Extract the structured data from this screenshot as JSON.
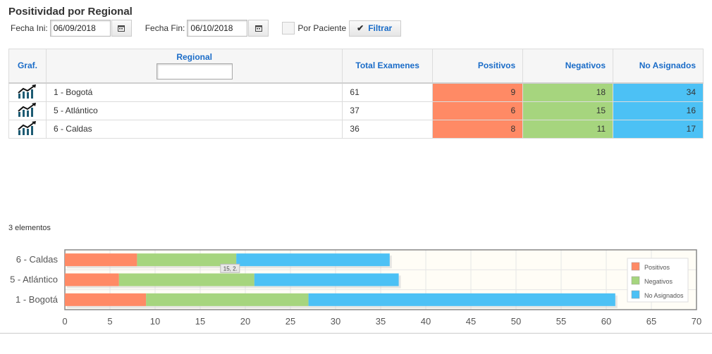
{
  "page": {
    "title": "Positividad por Regional"
  },
  "filters": {
    "fecha_ini_label": "Fecha Ini:",
    "fecha_ini_value": "06/09/2018",
    "fecha_fin_label": "Fecha Fin:",
    "fecha_fin_value": "06/10/2018",
    "por_paciente_label": "Por Paciente",
    "filtrar_label": "Filtrar",
    "calendar_icon": "calendar-icon"
  },
  "table": {
    "headers": {
      "graf": "Graf.",
      "regional": "Regional",
      "total": "Total Examenes",
      "positivos": "Positivos",
      "negativos": "Negativos",
      "no_asignados": "No Asignados"
    },
    "rows": [
      {
        "regional": "1 - Bogotá",
        "total": "61",
        "positivos": "9",
        "negativos": "18",
        "no_asignados": "34"
      },
      {
        "regional": "5 - Atlántico",
        "total": "37",
        "positivos": "6",
        "negativos": "15",
        "no_asignados": "16"
      },
      {
        "regional": "6 - Caldas",
        "total": "36",
        "positivos": "8",
        "negativos": "11",
        "no_asignados": "17"
      }
    ],
    "row_icon": "trend-chart-icon"
  },
  "count_label": "3 elementos",
  "colors": {
    "positivos": "#ff8a65",
    "negativos": "#a6d57e",
    "no_asignados": "#4cc1f5"
  },
  "chart_data": {
    "type": "bar",
    "orientation": "horizontal",
    "stacked": true,
    "categories": [
      "6 - Caldas",
      "5 - Atlántico",
      "1 - Bogotá"
    ],
    "series": [
      {
        "name": "Positivos",
        "values": [
          8,
          6,
          9
        ]
      },
      {
        "name": "Negativos",
        "values": [
          11,
          15,
          18
        ]
      },
      {
        "name": "No Asignados",
        "values": [
          17,
          16,
          34
        ]
      }
    ],
    "xlim": [
      0,
      70
    ],
    "xticks": [
      0,
      5,
      10,
      15,
      20,
      25,
      30,
      35,
      40,
      45,
      50,
      55,
      60,
      65,
      70
    ],
    "grid": true,
    "legend_position": "right",
    "tooltip": "15, 2."
  }
}
